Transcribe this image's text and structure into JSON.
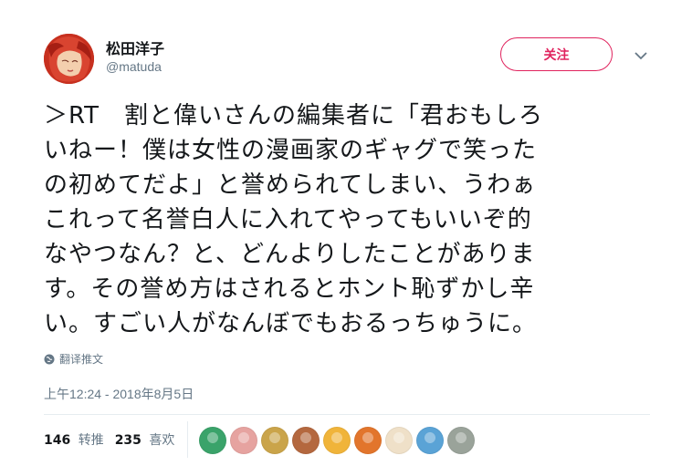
{
  "user": {
    "name": "松田洋子",
    "handle": "@matuda"
  },
  "actions": {
    "follow_label": "关注"
  },
  "tweet": {
    "lines": [
      "＞RT　割と偉いさんの編集者に「君おもしろ",
      "いねー！僕は女性の漫画家のギャグで笑った",
      "の初めてだよ」と誉められてしまい、うわぁ",
      "これって名誉白人に入れてやってもいいぞ的",
      "なやつなん？と、どんよりしたことがありま",
      "す。その誉め方はされるとホント恥ずかし辛",
      "い。すごい人がなんぼでもおるっちゅうに。"
    ],
    "translate_label": "翻译推文",
    "timestamp": "上午12:24 - 2018年8月5日"
  },
  "stats": {
    "retweets_count": "146",
    "retweets_label": "转推",
    "likes_count": "235",
    "likes_label": "喜欢"
  },
  "likers": [
    {
      "color": "#3aa36a"
    },
    {
      "color": "#e6a3a0"
    },
    {
      "color": "#caa44a"
    },
    {
      "color": "#b4683f"
    },
    {
      "color": "#f0b43a"
    },
    {
      "color": "#e2752c"
    },
    {
      "color": "#efe0c8"
    },
    {
      "color": "#5aa3d6"
    },
    {
      "color": "#9aa39a"
    }
  ],
  "colors": {
    "accent": "#e0245e",
    "text": "#14171a",
    "secondary": "#657786"
  }
}
